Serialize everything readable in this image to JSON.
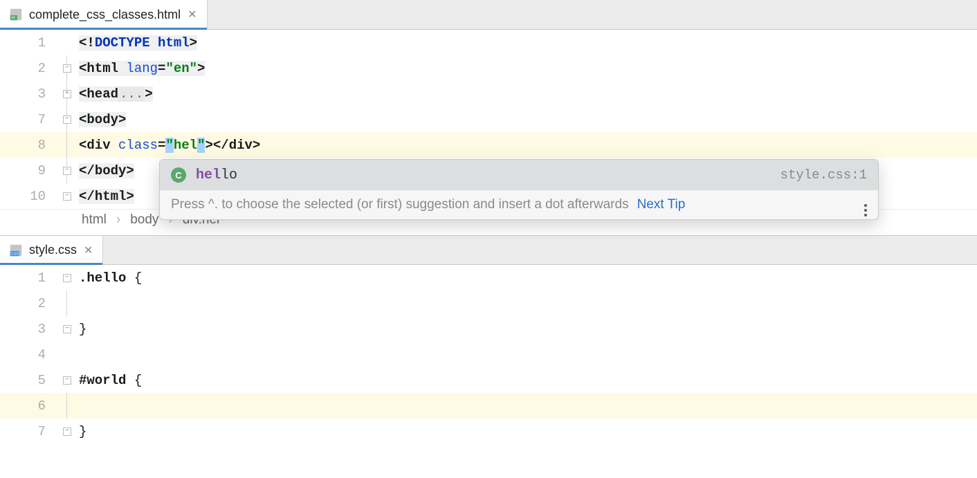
{
  "top": {
    "tab": {
      "filename": "complete_css_classes.html"
    },
    "lines": [
      {
        "num": "1"
      },
      {
        "num": "2"
      },
      {
        "num": "3"
      },
      {
        "num": "7"
      },
      {
        "num": "8"
      },
      {
        "num": "9"
      },
      {
        "num": "10"
      }
    ],
    "code": {
      "doctype_open": "<!",
      "doctype_kw": "DOCTYPE ",
      "doctype_html": "html",
      "doctype_close": ">",
      "html_open_lt": "<",
      "html_open_tag": "html ",
      "html_lang_attr": "lang",
      "html_lang_eq": "=",
      "html_lang_val": "\"en\"",
      "html_open_gt": ">",
      "head_lt": "<",
      "head_tag": "head",
      "head_dots": "...",
      "head_gt": ">",
      "body_lt": "<",
      "body_tag": "body",
      "body_gt": ">",
      "div_lt": "<",
      "div_tag": "div ",
      "div_class_attr": "class",
      "div_class_eq": "=",
      "div_class_q1": "\"",
      "div_class_val": "hel",
      "div_class_q2": "\"",
      "div_gt": ">",
      "div_close": "</",
      "div_close_tag": "div",
      "div_close_gt": ">",
      "body_close_lt": "</",
      "body_close_tag": "body",
      "body_close_gt": ">",
      "html_close_lt": "</",
      "html_close_tag": "html",
      "html_close_gt": ">"
    },
    "breadcrumb": {
      "a": "html",
      "b": "body",
      "c": "div.hel"
    }
  },
  "popup": {
    "badge": "C",
    "match": "hel",
    "rest": "lo",
    "source": "style.css:1",
    "hint": "Press ^. to choose the selected (or first) suggestion and insert a dot afterwards",
    "next_tip": "Next Tip"
  },
  "bottom": {
    "tab": {
      "filename": "style.css"
    },
    "lines": [
      {
        "num": "1"
      },
      {
        "num": "2"
      },
      {
        "num": "3"
      },
      {
        "num": "4"
      },
      {
        "num": "5"
      },
      {
        "num": "6"
      },
      {
        "num": "7"
      }
    ],
    "code": {
      "l1_sel": ".hello",
      "l1_brace": " {",
      "l3_close": "}",
      "l5_sel": "#world",
      "l5_brace": " {",
      "l7_close": "}"
    }
  }
}
